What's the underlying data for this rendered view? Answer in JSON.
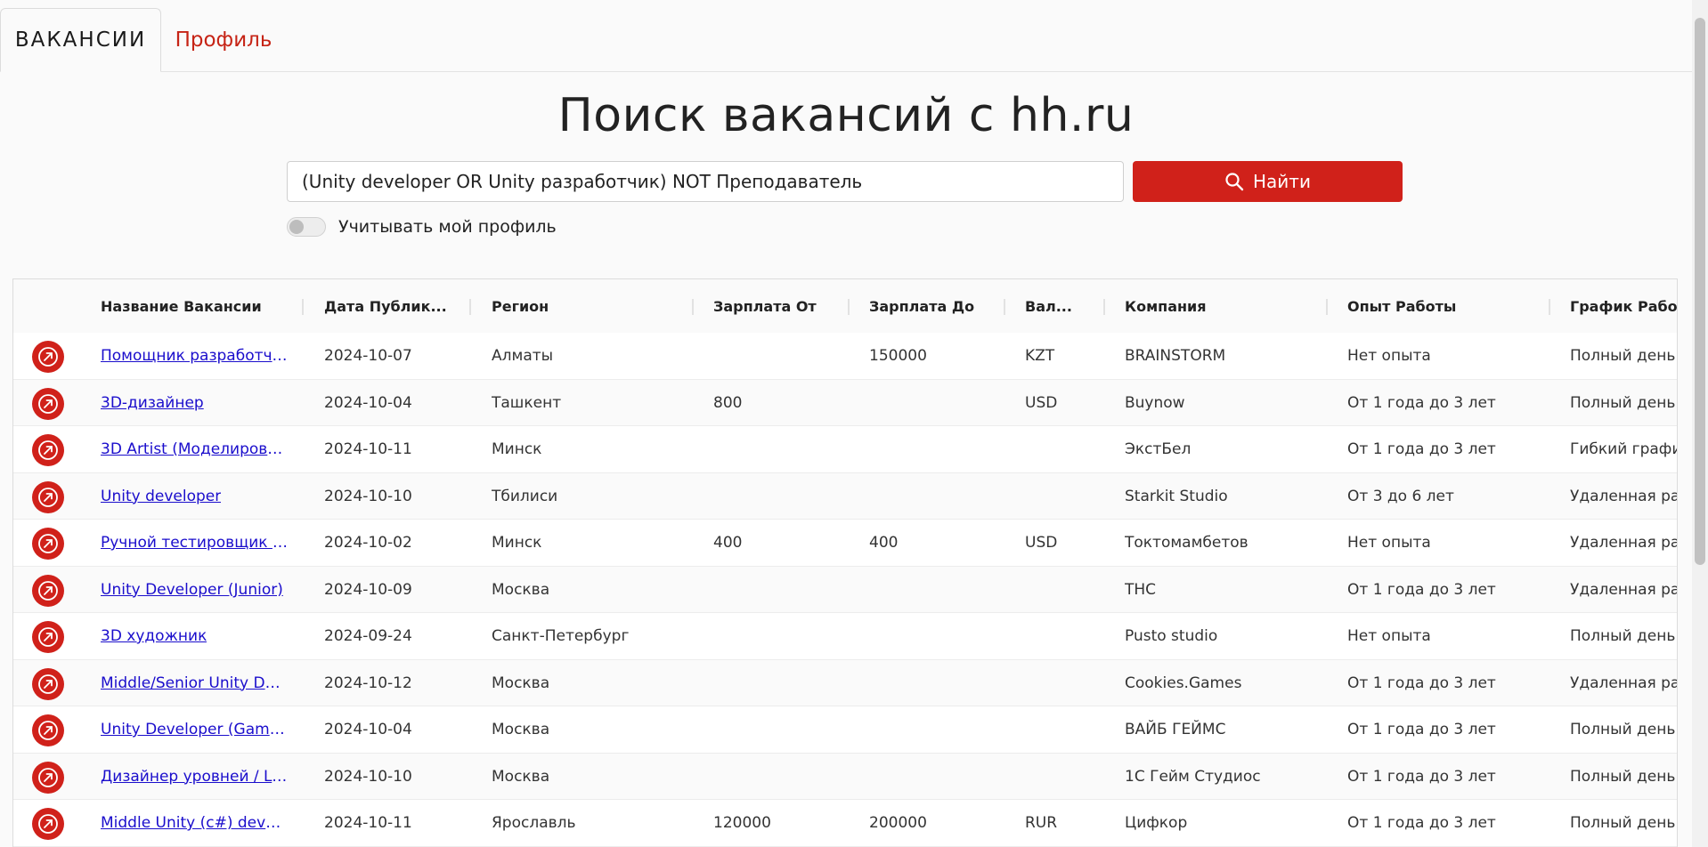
{
  "tabs": {
    "vacancies": "ВАКАНСИИ",
    "profile": "Профиль"
  },
  "title": "Поиск вакансий с hh.ru",
  "search": {
    "value": "(Unity developer OR Unity разработчик) NOT Преподаватель",
    "button_label": "Найти"
  },
  "toggle": {
    "label": "Учитывать мой профиль",
    "on": false
  },
  "table": {
    "columns": [
      "Название Вакансии",
      "Дата Публик...",
      "Регион",
      "Зарплата От",
      "Зарплата До",
      "Вал...",
      "Компания",
      "Опыт Работы",
      "График Работы"
    ],
    "rows": [
      {
        "title": "Помощник разработчи...",
        "date": "2024-10-07",
        "region": "Алматы",
        "from": "",
        "to": "150000",
        "currency": "KZT",
        "company": "BRAINSTORM",
        "experience": "Нет опыта",
        "schedule": "Полный день"
      },
      {
        "title": "3D-дизайнер",
        "date": "2024-10-04",
        "region": "Ташкент",
        "from": "800",
        "to": "",
        "currency": "USD",
        "company": "Buynow",
        "experience": "От 1 года до 3 лет",
        "schedule": "Полный день"
      },
      {
        "title": "3D Artist (Моделирован...",
        "date": "2024-10-11",
        "region": "Минск",
        "from": "",
        "to": "",
        "currency": "",
        "company": "ЭкстБел",
        "experience": "От 1 года до 3 лет",
        "schedule": "Гибкий график"
      },
      {
        "title": "Unity developer",
        "date": "2024-10-10",
        "region": "Тбилиси",
        "from": "",
        "to": "",
        "currency": "",
        "company": "Starkit Studio",
        "experience": "От 3 до 6 лет",
        "schedule": "Удаленная раб"
      },
      {
        "title": "Ручной тестировщик Q...",
        "date": "2024-10-02",
        "region": "Минск",
        "from": "400",
        "to": "400",
        "currency": "USD",
        "company": "Токтомамбетов",
        "experience": "Нет опыта",
        "schedule": "Удаленная раб"
      },
      {
        "title": "Unity Developer (Junior)",
        "date": "2024-10-09",
        "region": "Москва",
        "from": "",
        "to": "",
        "currency": "",
        "company": "THC",
        "experience": "От 1 года до 3 лет",
        "schedule": "Удаленная раб"
      },
      {
        "title": "3D художник",
        "date": "2024-09-24",
        "region": "Санкт-Петербург",
        "from": "",
        "to": "",
        "currency": "",
        "company": "Pusto studio",
        "experience": "Нет опыта",
        "schedule": "Полный день"
      },
      {
        "title": "Middle/Senior Unity Dev...",
        "date": "2024-10-12",
        "region": "Москва",
        "from": "",
        "to": "",
        "currency": "",
        "company": "Cookies.Games",
        "experience": "От 1 года до 3 лет",
        "schedule": "Удаленная раб"
      },
      {
        "title": "Unity Developer (Gamed...",
        "date": "2024-10-04",
        "region": "Москва",
        "from": "",
        "to": "",
        "currency": "",
        "company": "ВАЙБ ГЕЙМС",
        "experience": "От 1 года до 3 лет",
        "schedule": "Полный день"
      },
      {
        "title": "Дизайнер уровней / Le...",
        "date": "2024-10-10",
        "region": "Москва",
        "from": "",
        "to": "",
        "currency": "",
        "company": "1С Гейм Студиос",
        "experience": "От 1 года до 3 лет",
        "schedule": "Полный день"
      },
      {
        "title": "Middle Unity (c#) develo...",
        "date": "2024-10-11",
        "region": "Ярославль",
        "from": "120000",
        "to": "200000",
        "currency": "RUR",
        "company": "Цифкор",
        "experience": "От 1 года до 3 лет",
        "schedule": "Полный день"
      }
    ]
  },
  "colors": {
    "accent": "#d0211a",
    "link": "#1a0dcc"
  },
  "icons": {
    "search_button": "search-icon",
    "row_action": "open-external-icon"
  }
}
